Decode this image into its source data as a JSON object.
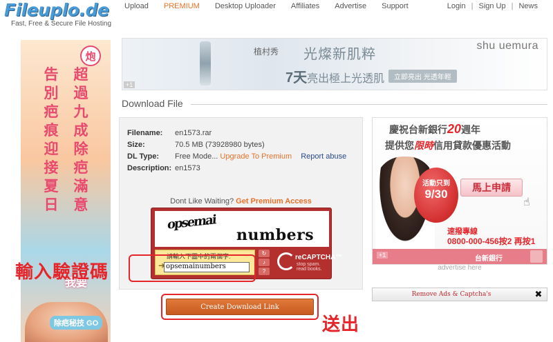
{
  "header": {
    "logo": "Fileuplo.de",
    "tagline": "Fast, Free & Secure File Hosting",
    "nav": [
      "Upload",
      "PREMIUM",
      "Desktop Uploader",
      "Affiliates",
      "Advertise",
      "Support"
    ],
    "user_nav": [
      "Login",
      "Sign Up",
      "News"
    ],
    "separator": "|"
  },
  "left_ad": {
    "seal": "炮",
    "col1": "告別疤痕迎接夏日",
    "col2": "超過九成除疤滿意",
    "bottom_text": "我要",
    "go_label": "除疤秘技 GO"
  },
  "top_banner": {
    "brand_cn": "植村秀",
    "slogan1": "光燦新肌粹",
    "slogan2_prefix": "7天",
    "slogan2_suffix": "亮出極上光透肌",
    "cta": "立即亮出  光透年輕",
    "brand": "shu uemura",
    "plus": "+1"
  },
  "download": {
    "heading": "Download File",
    "rows": [
      {
        "label": "Filename:",
        "value": "en1573.rar"
      },
      {
        "label": "Size:",
        "value": "70.5 MB (73928980 bytes)"
      },
      {
        "label": "DL Type:",
        "value": "Free Mode...",
        "link1": "Upgrade To Premium",
        "link2": "Report abuse"
      },
      {
        "label": "Description:",
        "value": "en1573"
      }
    ],
    "waiting_text": "Dont Like Waiting?",
    "premium_link": "Get Premium Access",
    "captcha": {
      "word1": "opsemai",
      "word2": "numbers",
      "prompt": "請輸入下圖中的兩個字:",
      "input_value": "opsemainumbers",
      "brand": "reCAPTCHA™",
      "sub1": "stop spam.",
      "sub2": "read books."
    },
    "create_button": "Create Download Link"
  },
  "annotations": {
    "label1": "輸入驗證碼",
    "label2": "送出"
  },
  "right_ad": {
    "line1_prefix": "慶祝台新銀行",
    "line1_num": "20",
    "line1_suffix": "週年",
    "line2_prefix": "提供您",
    "line2_red": "限時",
    "line2_suffix": "信用貸款優惠活動",
    "balloon_t1": "活動只到",
    "balloon_t2": "9/30",
    "apply": "馬上申請",
    "hotline": "速撥專線",
    "phone": "0800-000-456按2 再按1",
    "bank": "台新銀行",
    "plus": "+1",
    "advertise_here": "advertise here"
  },
  "remove_ads": {
    "label": "Remove Ads & Captcha's",
    "close": "✖"
  }
}
